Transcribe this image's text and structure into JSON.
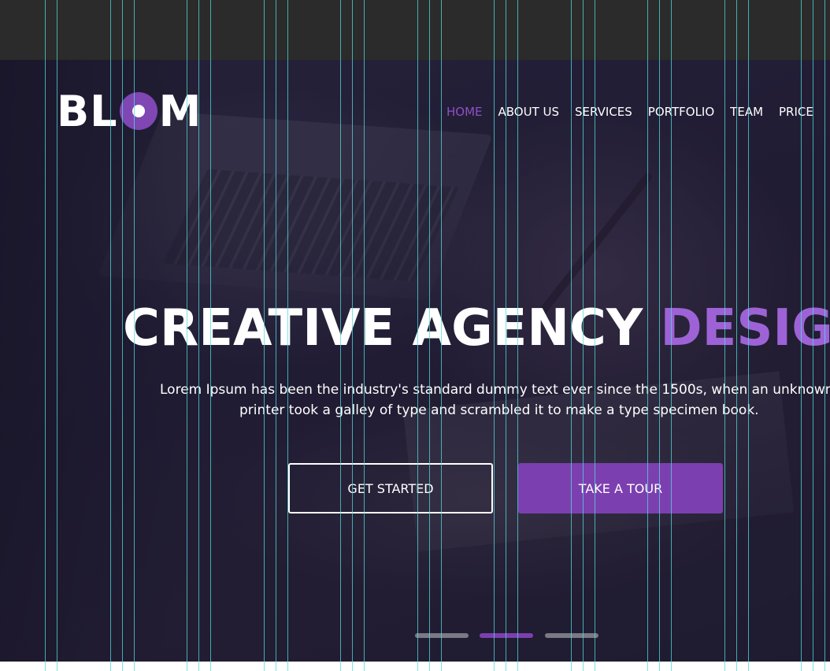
{
  "brand": {
    "logo_text_before": "BL",
    "logo_text_after": "M",
    "accent_color": "#7f46b4"
  },
  "nav": {
    "items": [
      {
        "label": "HOME",
        "active": true
      },
      {
        "label": "ABOUT US",
        "active": false
      },
      {
        "label": "SERVICES",
        "active": false
      },
      {
        "label": "PORTFOLIO",
        "active": false
      },
      {
        "label": "TEAM",
        "active": false
      },
      {
        "label": "PRICE",
        "active": false
      }
    ]
  },
  "hero": {
    "headline_white": "CREATIVE AGENCY ",
    "headline_accent": "DESIGN",
    "description_line1": "Lorem Ipsum has been the industry's standard dummy text ever since the 1500s, when an unknown",
    "description_line2": "printer took a galley of type and scrambled it to make a type specimen book.",
    "primary_button": "GET STARTED",
    "secondary_button": "TAKE A TOUR"
  },
  "slider": {
    "slide_count": 3,
    "active_index": 1
  }
}
